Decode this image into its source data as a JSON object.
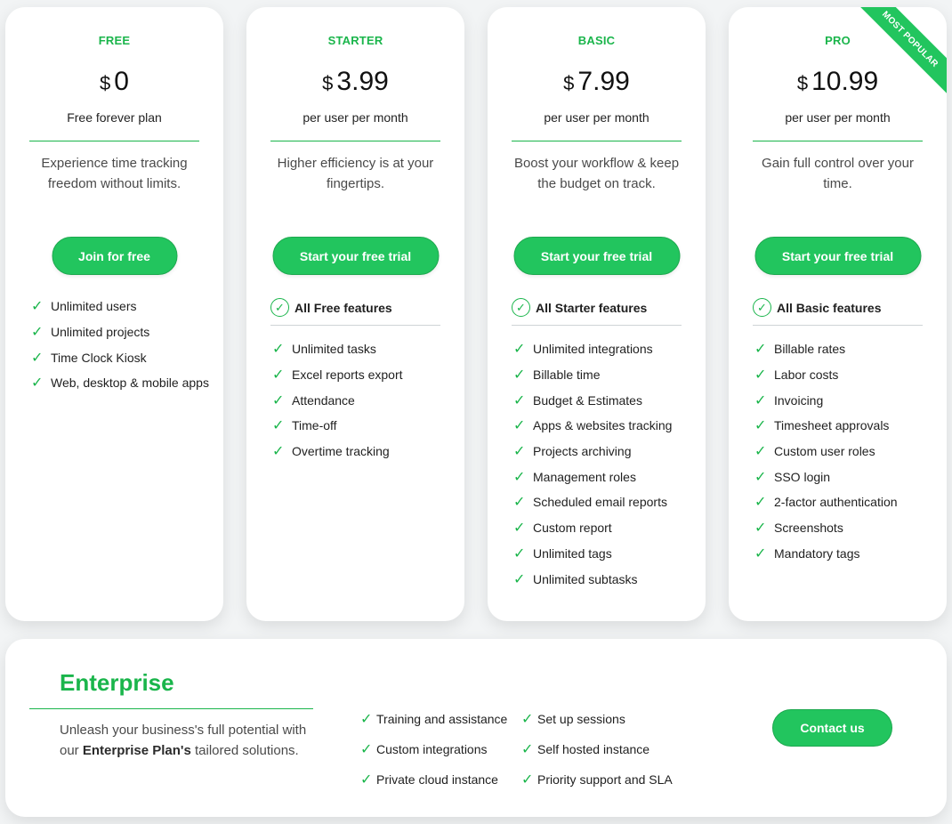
{
  "plans": [
    {
      "name": "FREE",
      "currency": "$",
      "price": "0",
      "period": "Free forever plan",
      "description": "Experience time tracking freedom without limits.",
      "cta": "Join for free",
      "included": "",
      "features": [
        "Unlimited users",
        "Unlimited projects",
        "Time Clock Kiosk",
        "Web, desktop & mobile apps"
      ]
    },
    {
      "name": "STARTER",
      "currency": "$",
      "price": "3.99",
      "period": "per user per month",
      "description": "Higher efficiency is at your fingertips.",
      "cta": "Start your free trial",
      "included": "All Free features",
      "features": [
        "Unlimited tasks",
        "Excel reports export",
        "Attendance",
        "Time-off",
        "Overtime tracking"
      ]
    },
    {
      "name": "BASIC",
      "currency": "$",
      "price": "7.99",
      "period": "per user per month",
      "description": "Boost your workflow & keep the budget on track.",
      "cta": "Start your free trial",
      "included": "All Starter features",
      "features": [
        "Unlimited integrations",
        "Billable time",
        "Budget & Estimates",
        "Apps & websites tracking",
        "Projects archiving",
        "Management roles",
        "Scheduled email reports",
        "Custom report",
        "Unlimited tags",
        "Unlimited subtasks"
      ]
    },
    {
      "name": "PRO",
      "currency": "$",
      "price": "10.99",
      "period": "per user per month",
      "description": "Gain full control over your time.",
      "cta": "Start your free trial",
      "included": "All Basic features",
      "badge": "MOST POPULAR",
      "features": [
        "Billable rates",
        "Labor costs",
        "Invoicing",
        "Timesheet approvals",
        "Custom user roles",
        "SSO login",
        "2-factor authentication",
        "Screenshots",
        "Mandatory tags"
      ]
    }
  ],
  "enterprise": {
    "title": "Enterprise",
    "desc_pre": "Unleash your business's full potential with our ",
    "desc_bold": "Enterprise Plan's",
    "desc_post": " tailored solutions.",
    "features": [
      "Training and assistance",
      "Set up sessions",
      "Custom integrations",
      "Self hosted instance",
      "Private cloud instance",
      "Priority support and SLA"
    ],
    "cta": "Contact us"
  },
  "icons": {
    "check": "✓"
  },
  "colors": {
    "accent": "#22c55e",
    "accent_text": "#1ab54b",
    "background": "#f2f4f5"
  }
}
